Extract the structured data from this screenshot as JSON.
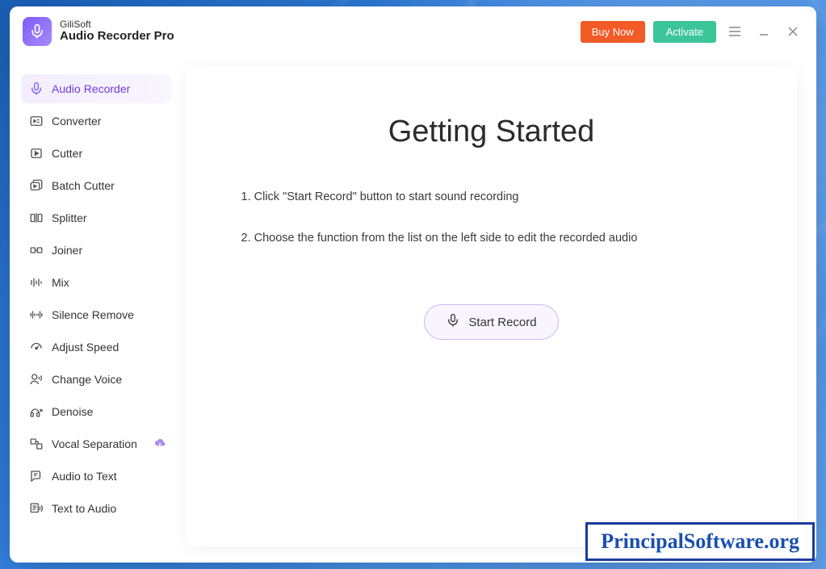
{
  "brand": {
    "line1": "GiliSoft",
    "line2": "Audio Recorder Pro"
  },
  "titlebar": {
    "buy_label": "Buy Now",
    "activate_label": "Activate"
  },
  "sidebar": {
    "items": [
      {
        "label": "Audio Recorder",
        "icon": "microphone-icon",
        "active": true
      },
      {
        "label": "Converter",
        "icon": "converter-icon"
      },
      {
        "label": "Cutter",
        "icon": "cutter-icon"
      },
      {
        "label": "Batch Cutter",
        "icon": "batch-cutter-icon"
      },
      {
        "label": "Splitter",
        "icon": "splitter-icon"
      },
      {
        "label": "Joiner",
        "icon": "joiner-icon"
      },
      {
        "label": "Mix",
        "icon": "mix-icon"
      },
      {
        "label": "Silence Remove",
        "icon": "silence-icon"
      },
      {
        "label": "Adjust Speed",
        "icon": "speed-icon"
      },
      {
        "label": "Change Voice",
        "icon": "voice-icon"
      },
      {
        "label": "Denoise",
        "icon": "denoise-icon"
      },
      {
        "label": "Vocal Separation",
        "icon": "vocal-sep-icon",
        "badge": "cloud-download-icon"
      },
      {
        "label": "Audio to Text",
        "icon": "audio-to-text-icon"
      },
      {
        "label": "Text to Audio",
        "icon": "text-to-audio-icon"
      }
    ]
  },
  "main": {
    "heading": "Getting Started",
    "step1": "1. Click \"Start Record\" button to start sound recording",
    "step2": "2. Choose the function from the list on the left side to edit the recorded audio",
    "start_record_label": "Start Record"
  },
  "watermark": "PrincipalSoftware.org",
  "colors": {
    "accent": "#7c5cf5",
    "buy": "#f25a26",
    "activate": "#3dc59a"
  }
}
